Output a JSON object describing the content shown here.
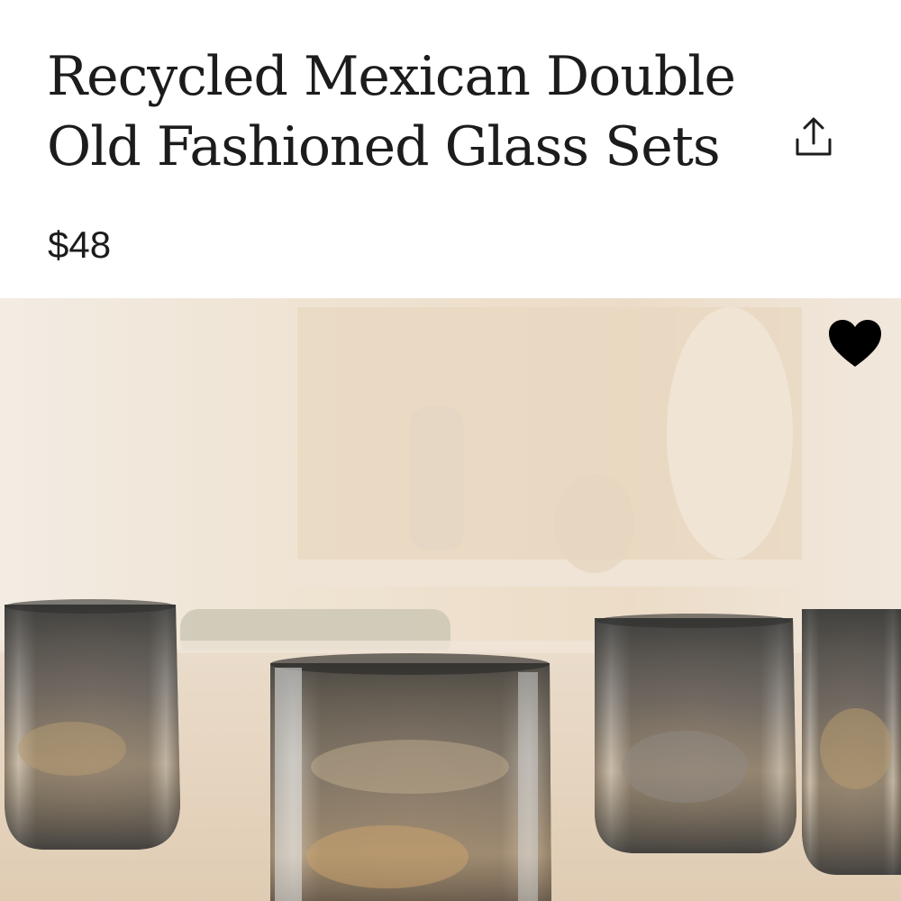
{
  "product": {
    "title": "Recycled Mexican Double Old Fashioned Glass Sets",
    "price": "$48"
  },
  "actions": {
    "share_icon": "share-upload-icon",
    "favorite_icon": "heart-icon",
    "favorite_color": "#000000"
  },
  "image": {
    "subject": "smoke-tinted recycled glass tumblers on wooden table"
  },
  "colors": {
    "text": "#1c1c1c",
    "background": "#ffffff",
    "scene_wall": "#efe6da",
    "scene_table": "#e7d6c1"
  }
}
